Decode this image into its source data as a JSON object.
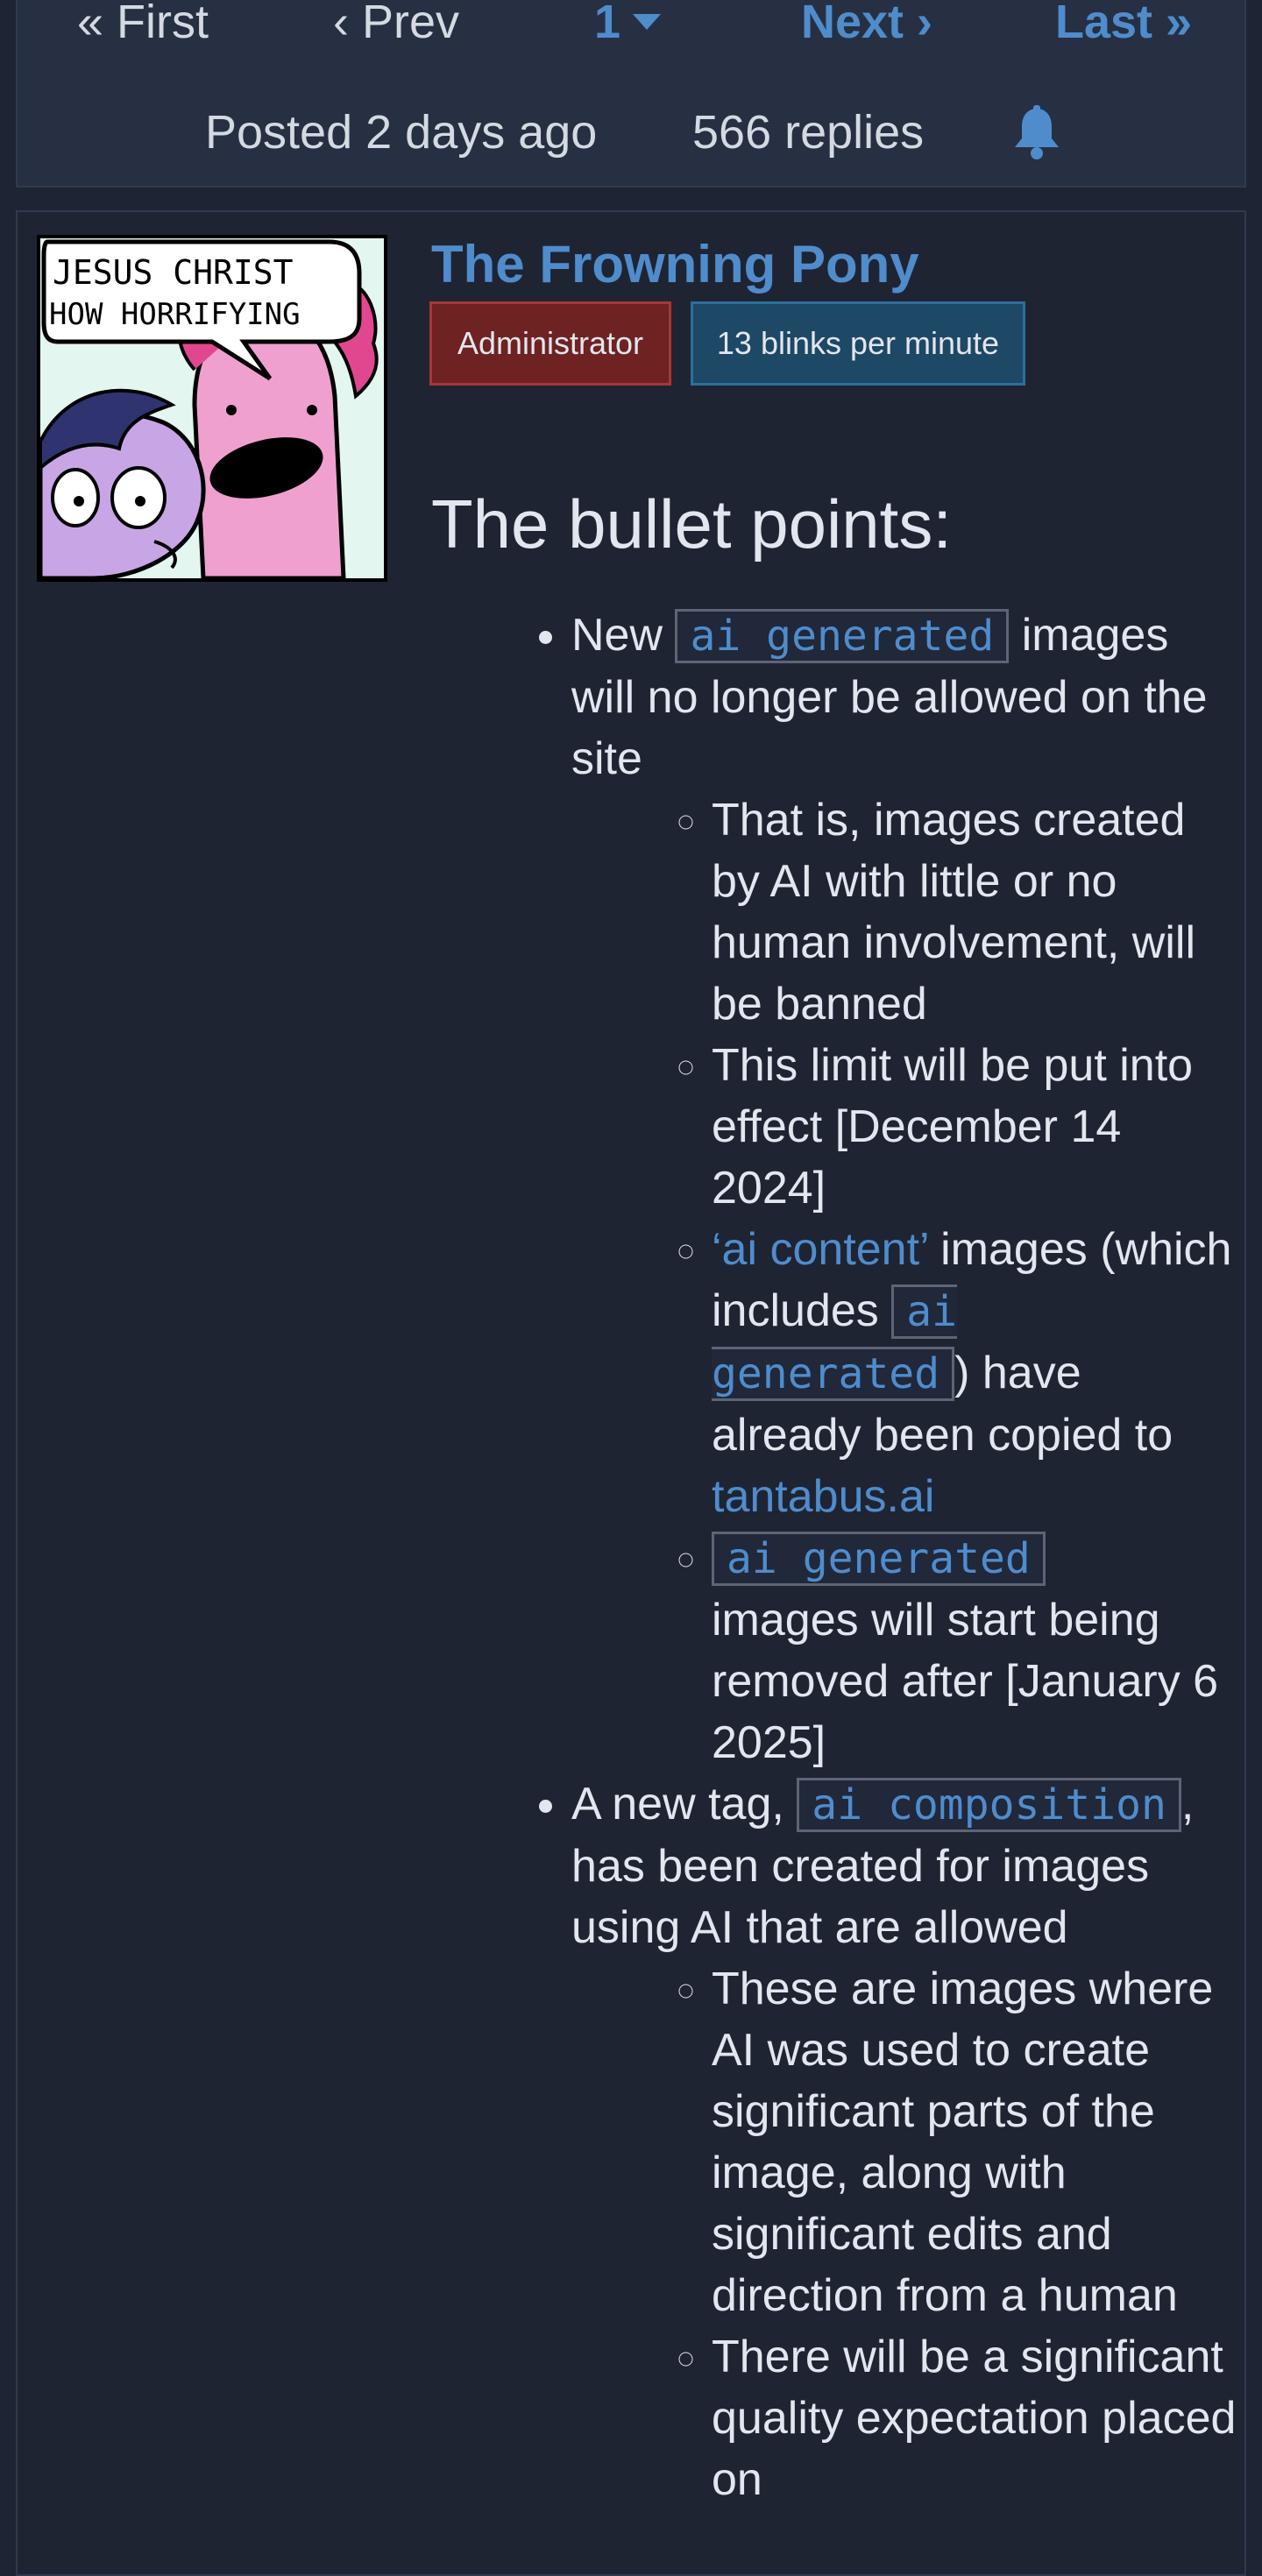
{
  "pagination": {
    "first": "« First",
    "prev": "‹ Prev",
    "current": "1",
    "next": "Next ›",
    "last": "Last »"
  },
  "topic_meta": {
    "posted": "Posted 2 days ago",
    "replies": "566 replies",
    "subscribe_icon": "bell-icon"
  },
  "post": {
    "avatar_text_line1": "JESUS CHRIST",
    "avatar_text_line2": "HOW HORRIFYING",
    "author": "The Frowning Pony",
    "badges": [
      "Administrator",
      "13 blinks per minute"
    ],
    "heading": "The bullet points:",
    "bullets": [
      {
        "pre": "New ",
        "tag": "ai generated",
        "post": " images will no longer be allowed on the site",
        "sub": [
          {
            "text": "That is, images created by AI with little or no human involvement, will be banned"
          },
          {
            "text": "This limit will be put into effect [December 14 2024]"
          },
          {
            "link": "‘ai content’",
            "pre": " images (which includes ",
            "tag": "ai generated",
            "mid": ") have already been copied to ",
            "link2": "tantabus.ai"
          },
          {
            "tag": "ai generated",
            "post": " images will start being removed after [January 6 2025]"
          }
        ]
      },
      {
        "pre": "A new tag, ",
        "tag": "ai composition",
        "post": ", has been created for images using AI that are allowed",
        "sub": [
          {
            "text": "These are images where AI was used to create significant parts of the image, along with significant edits and direction from a human"
          },
          {
            "text": "There will be a significant quality expectation placed on"
          }
        ]
      }
    ]
  },
  "colors": {
    "background": "#1e2433",
    "panel": "#263042",
    "link": "#4f8ccc",
    "admin_badge": "#6e2222",
    "blinks_badge": "#1d4866"
  }
}
